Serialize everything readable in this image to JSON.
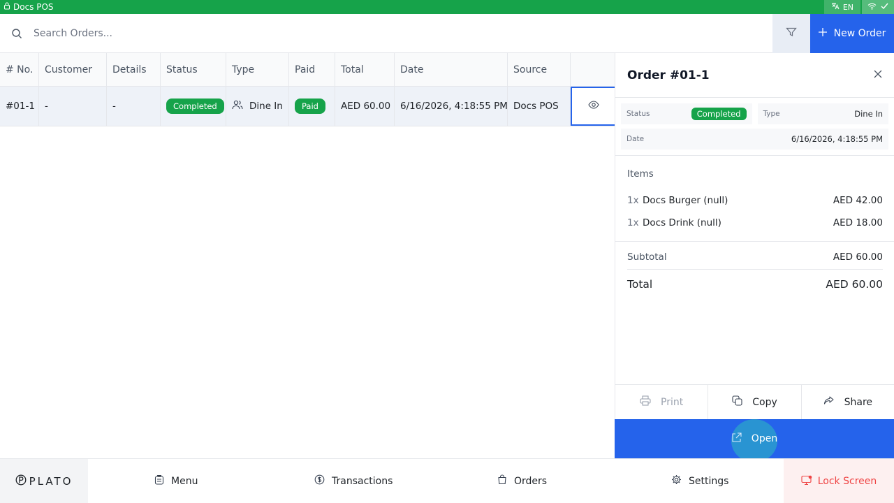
{
  "window": {
    "title": "Docs POS"
  },
  "topbar": {
    "language": "EN"
  },
  "search": {
    "placeholder": "Search Orders..."
  },
  "toolbar": {
    "new_order_label": "New Order"
  },
  "table": {
    "columns": [
      "# No.",
      "Customer",
      "Details",
      "Status",
      "Type",
      "Paid",
      "Total",
      "Date",
      "Source"
    ],
    "rows": [
      {
        "no": "#01-1",
        "customer": "-",
        "details": "-",
        "status": "Completed",
        "type": "Dine In",
        "paid": "Paid",
        "total": "AED 60.00",
        "date": "6/16/2026, 4:18:55 PM",
        "source": "Docs POS"
      }
    ]
  },
  "order_panel": {
    "title": "Order #01-1",
    "status_label": "Status",
    "status_value": "Completed",
    "type_label": "Type",
    "type_value": "Dine In",
    "date_label": "Date",
    "date_value": "6/16/2026, 4:18:55 PM",
    "items_title": "Items",
    "items": [
      {
        "qty": "1x",
        "name": "Docs Burger (null)",
        "price": "AED 42.00"
      },
      {
        "qty": "1x",
        "name": "Docs Drink (null)",
        "price": "AED 18.00"
      }
    ],
    "subtotal_label": "Subtotal",
    "subtotal_value": "AED 60.00",
    "total_label": "Total",
    "total_value": "AED 60.00",
    "actions": {
      "print": "Print",
      "copy": "Copy",
      "share": "Share",
      "open": "Open"
    }
  },
  "bottom_nav": {
    "logo": "PLATO",
    "menu": "Menu",
    "transactions": "Transactions",
    "orders": "Orders",
    "settings": "Settings",
    "lock": "Lock Screen"
  },
  "colors": {
    "brand_green": "#16a34a",
    "accent_blue": "#2563eb",
    "danger_red": "#ef4444"
  }
}
